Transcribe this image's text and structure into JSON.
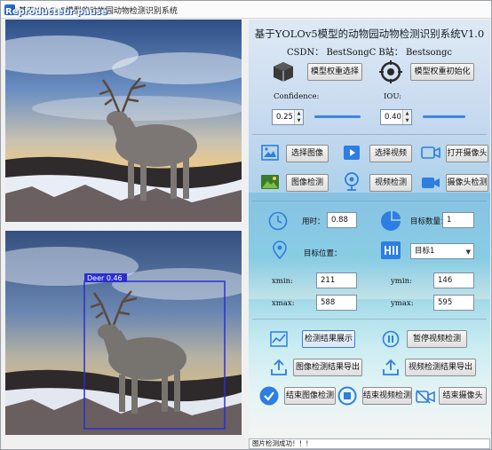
{
  "window": {
    "title": "基于YOLOv5模型的动物园动物检测识别系统",
    "overlay_label": "Reproducteur pausé"
  },
  "header": {
    "title": "基于YOLOv5模型的动物园动物检测识别系统V1.0",
    "credits": "CSDN：  BestSongC    B站：  Bestsongc"
  },
  "model": {
    "select_weights_label": "模型权重选择",
    "init_weights_label": "模型权重初始化"
  },
  "thresholds": {
    "confidence_label": "Confidence:",
    "confidence_value": "0.25",
    "iou_label": "IOU:",
    "iou_value": "0.40"
  },
  "actions": {
    "select_image": "选择图像",
    "select_video": "选择视频",
    "open_camera": "打开摄像头",
    "image_detect": "图像检测",
    "video_detect": "视频检测",
    "camera_detect": "摄像头检测"
  },
  "stats": {
    "time_label": "用时：",
    "time_value": "0.88",
    "count_label": "目标数量：",
    "count_value": "1",
    "position_label": "目标位置：",
    "target_select": "目标1",
    "xmin_label": "xmin:",
    "xmin_value": "211",
    "ymin_label": "ymin:",
    "ymin_value": "146",
    "xmax_label": "xmax:",
    "xmax_value": "588",
    "ymax_label": "ymax:",
    "ymax_value": "595"
  },
  "controls": {
    "show_results": "检测结果展示",
    "pause_video": "暂停视频检测",
    "export_image": "图像检测结果导出",
    "export_video": "视频检测结果导出",
    "end_image": "结束图像检测",
    "end_video": "结束视频检测",
    "end_camera": "结束摄像头"
  },
  "detection": {
    "label": "Deer 0.46"
  },
  "status": {
    "message": "图片检测成功！！！"
  },
  "icons": {
    "cube": "cube-icon",
    "settings": "target-gear-icon",
    "image": "image-icon",
    "video": "play-video-icon",
    "camera": "camera-icon",
    "landscape": "landscape-image-icon",
    "webcam": "webcam-icon",
    "video_camera": "video-camera-icon",
    "clock": "clock-icon",
    "pie": "pie-chart-icon",
    "location": "location-pin-icon",
    "hi": "hi-icon",
    "chart": "line-chart-icon",
    "pause": "pause-icon",
    "upload": "upload-icon",
    "check": "check-circle-icon",
    "stop": "stop-circle-icon",
    "video_off": "video-off-icon"
  },
  "colors": {
    "accent": "#2d7ee0",
    "detection_box": "#2b2fd1"
  }
}
